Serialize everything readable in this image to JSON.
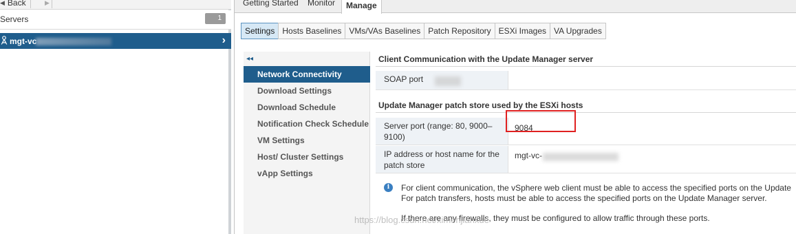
{
  "nav": {
    "back_label": "Back",
    "servers_label": "Servers",
    "servers_count": "1",
    "server_name": "mgt-vc"
  },
  "main_tabs": [
    {
      "label": "Getting Started"
    },
    {
      "label": "Monitor"
    },
    {
      "label": "Manage"
    }
  ],
  "sub_tabs": [
    {
      "label": "Settings"
    },
    {
      "label": "Hosts Baselines"
    },
    {
      "label": "VMs/VAs Baselines"
    },
    {
      "label": "Patch Repository"
    },
    {
      "label": "ESXi Images"
    },
    {
      "label": "VA Upgrades"
    }
  ],
  "settings_nav": [
    {
      "label": "Network Connectivity"
    },
    {
      "label": "Download Settings"
    },
    {
      "label": "Download Schedule"
    },
    {
      "label": "Notification Check Schedule"
    },
    {
      "label": "VM Settings"
    },
    {
      "label": "Host/ Cluster Settings"
    },
    {
      "label": "vApp Settings"
    }
  ],
  "client_section": {
    "title": "Client Communication with the Update Manager server",
    "soap_label": "SOAP port"
  },
  "patch_section": {
    "title": "Update Manager patch store used by the ESXi hosts",
    "server_port_label": "Server port (range: 80, 9000–9100)",
    "server_port_value": "9084",
    "ip_label": "IP address or host name for the patch store",
    "ip_value": "mgt-vc-"
  },
  "info": {
    "line1": "For client communication, the vSphere web client must be able to access the specified ports on the Update",
    "line2": "For patch transfers, hosts must be able to access the specified ports on the Update Manager server.",
    "line3": "If there are any firewalls, they must be configured to allow traffic through these ports."
  },
  "watermark": "https://blog.csdn.net/ximenjianxue",
  "colors": {
    "selection_blue": "#1f5d8c",
    "highlight_red": "#e02020",
    "info_blue": "#3a7fc1"
  }
}
